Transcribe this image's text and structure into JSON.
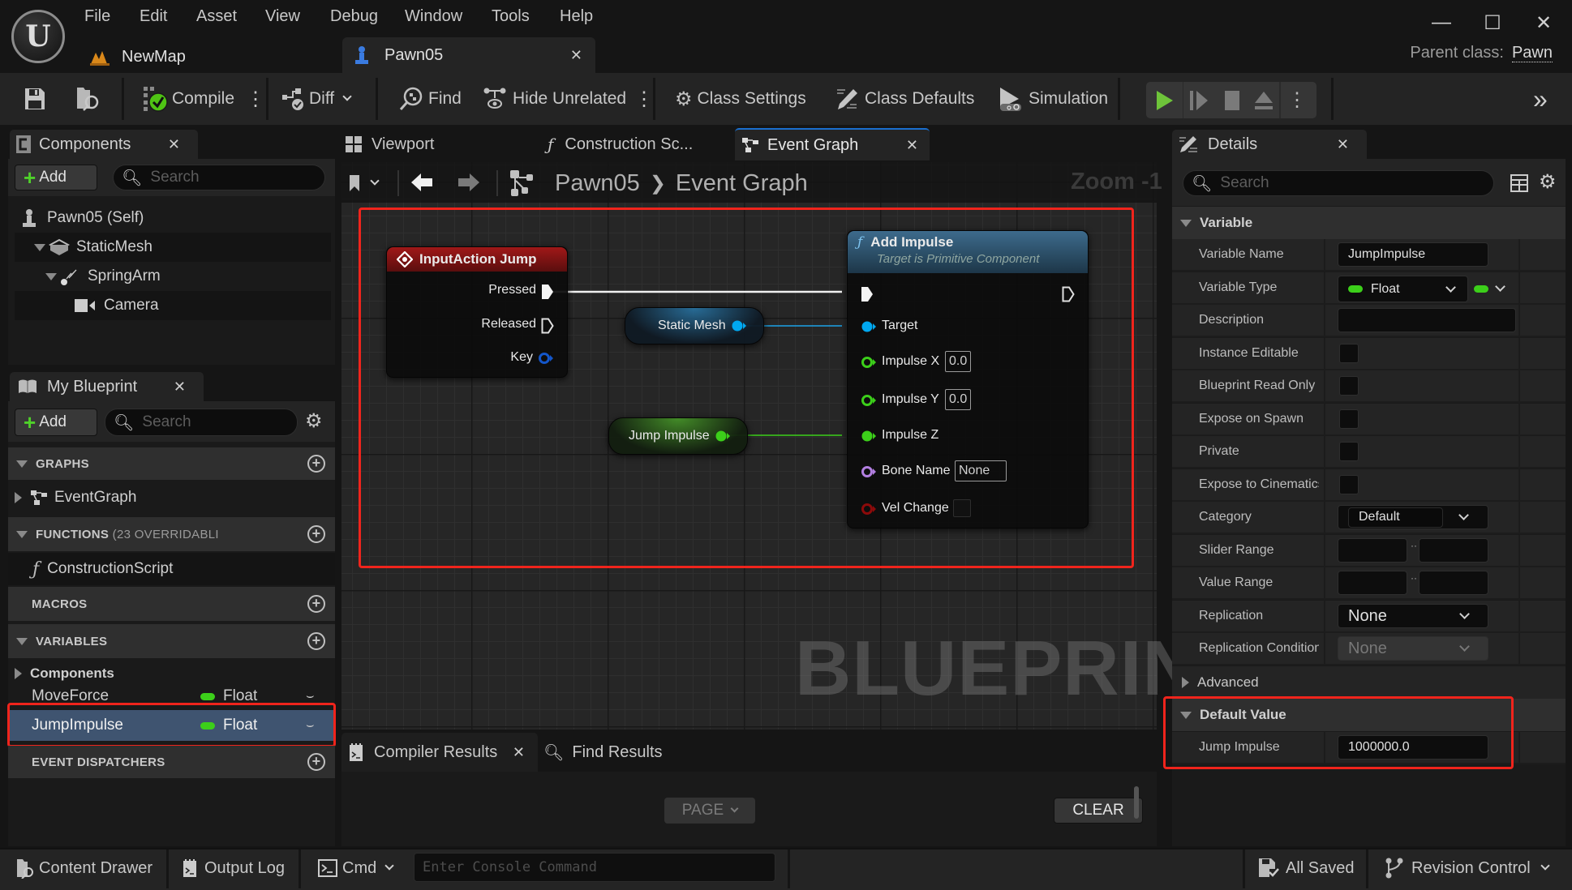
{
  "app": {
    "menu": [
      "File",
      "Edit",
      "Asset",
      "View",
      "Debug",
      "Window",
      "Tools",
      "Help"
    ],
    "doc_tabs": [
      {
        "label": "NewMap",
        "icon": "level-icon",
        "active": false
      },
      {
        "label": "Pawn05",
        "icon": "pawn-icon",
        "active": true
      }
    ],
    "parent_class_label": "Parent class:",
    "parent_class_value": "Pawn",
    "window_controls": {
      "minimize": "—",
      "maximize": "☐",
      "close": "✕"
    }
  },
  "toolbar": {
    "save_icon": "save-icon",
    "browse_icon": "browse-icon",
    "compile": "Compile",
    "diff": "Diff",
    "find": "Find",
    "hide_unrelated": "Hide Unrelated",
    "class_settings": "Class Settings",
    "class_defaults": "Class Defaults",
    "simulation": "Simulation",
    "play_controls": [
      "play",
      "step",
      "stop",
      "eject",
      "more"
    ]
  },
  "components_panel": {
    "title": "Components",
    "add_label": "Add",
    "search_placeholder": "Search",
    "tree": [
      {
        "label": "Pawn05 (Self)",
        "icon": "pawn-icon",
        "depth": 0
      },
      {
        "label": "StaticMesh",
        "icon": "static-mesh-icon",
        "depth": 1,
        "expanded": true
      },
      {
        "label": "SpringArm",
        "icon": "spring-arm-icon",
        "depth": 2,
        "expanded": true
      },
      {
        "label": "Camera",
        "icon": "camera-icon",
        "depth": 3
      }
    ]
  },
  "my_blueprint": {
    "title": "My Blueprint",
    "add_label": "Add",
    "search_placeholder": "Search",
    "sections": {
      "graphs": "GRAPHS",
      "functions": "FUNCTIONS",
      "functions_suffix": "(23 OVERRIDABLI",
      "macros": "MACROS",
      "variables": "VARIABLES",
      "event_dispatchers": "EVENT DISPATCHERS"
    },
    "graphs": [
      "EventGraph"
    ],
    "functions": [
      "ConstructionScript"
    ],
    "variable_groups": [
      "Components"
    ],
    "variables": [
      {
        "name": "MoveForce",
        "type": "Float",
        "selected": false
      },
      {
        "name": "JumpImpulse",
        "type": "Float",
        "selected": true
      }
    ]
  },
  "editor_tabs": [
    {
      "label": "Viewport",
      "active": false
    },
    {
      "label": "Construction Sc...",
      "active": false
    },
    {
      "label": "Event Graph",
      "active": true
    }
  ],
  "graph": {
    "breadcrumb": [
      "Pawn05",
      "Event Graph"
    ],
    "zoom_label": "Zoom -1",
    "watermark": "BLUEPRINT",
    "nodes": {
      "input_action": {
        "title": "InputAction Jump",
        "pins": [
          "Pressed",
          "Released",
          "Key"
        ]
      },
      "add_impulse": {
        "title": "Add Impulse",
        "subtitle": "Target is Primitive Component",
        "pins": [
          {
            "label": "Target"
          },
          {
            "label": "Impulse X",
            "value": "0.0"
          },
          {
            "label": "Impulse Y",
            "value": "0.0"
          },
          {
            "label": "Impulse Z"
          },
          {
            "label": "Bone Name",
            "value": "None"
          },
          {
            "label": "Vel Change",
            "value": ""
          }
        ]
      },
      "static_mesh_var": {
        "label": "Static Mesh"
      },
      "jump_impulse_var": {
        "label": "Jump Impulse"
      }
    },
    "colors": {
      "exec": "#ffffff",
      "object": "#00a8f0",
      "float": "#3ccf1a",
      "name": "#b27fe0",
      "bool": "#8c0a0a",
      "struct_key": "#1456c9"
    }
  },
  "bottom_panel": {
    "tabs": [
      {
        "label": "Compiler Results",
        "active": true
      },
      {
        "label": "Find Results",
        "active": false
      }
    ],
    "page_label": "PAGE",
    "clear_label": "CLEAR"
  },
  "details": {
    "title": "Details",
    "search_placeholder": "Search",
    "variable_section": "Variable",
    "rows": [
      {
        "label": "Variable Name",
        "kind": "text",
        "value": "JumpImpulse"
      },
      {
        "label": "Variable Type",
        "kind": "type",
        "value": "Float"
      },
      {
        "label": "Description",
        "kind": "text",
        "value": ""
      },
      {
        "label": "Instance Editable",
        "kind": "check",
        "value": false
      },
      {
        "label": "Blueprint Read Only",
        "kind": "check",
        "value": false
      },
      {
        "label": "Expose on Spawn",
        "kind": "check",
        "value": false
      },
      {
        "label": "Private",
        "kind": "check",
        "value": false
      },
      {
        "label": "Expose to Cinematics",
        "kind": "check",
        "value": false
      },
      {
        "label": "Category",
        "kind": "combo",
        "value": "Default"
      },
      {
        "label": "Slider Range",
        "kind": "range",
        "value": [
          "",
          ""
        ]
      },
      {
        "label": "Value Range",
        "kind": "range",
        "value": [
          "",
          ""
        ]
      },
      {
        "label": "Replication",
        "kind": "select",
        "value": "None"
      },
      {
        "label": "Replication Condition",
        "kind": "select-disabled",
        "value": "None"
      }
    ],
    "advanced_section": "Advanced",
    "default_value_section": "Default Value",
    "default_value_row": {
      "label": "Jump Impulse",
      "value": "1000000.0"
    }
  },
  "status_bar": {
    "content_drawer": "Content Drawer",
    "output_log": "Output Log",
    "cmd": "Cmd",
    "console_placeholder": "Enter Console Command",
    "all_saved": "All Saved",
    "revision_control": "Revision Control"
  }
}
